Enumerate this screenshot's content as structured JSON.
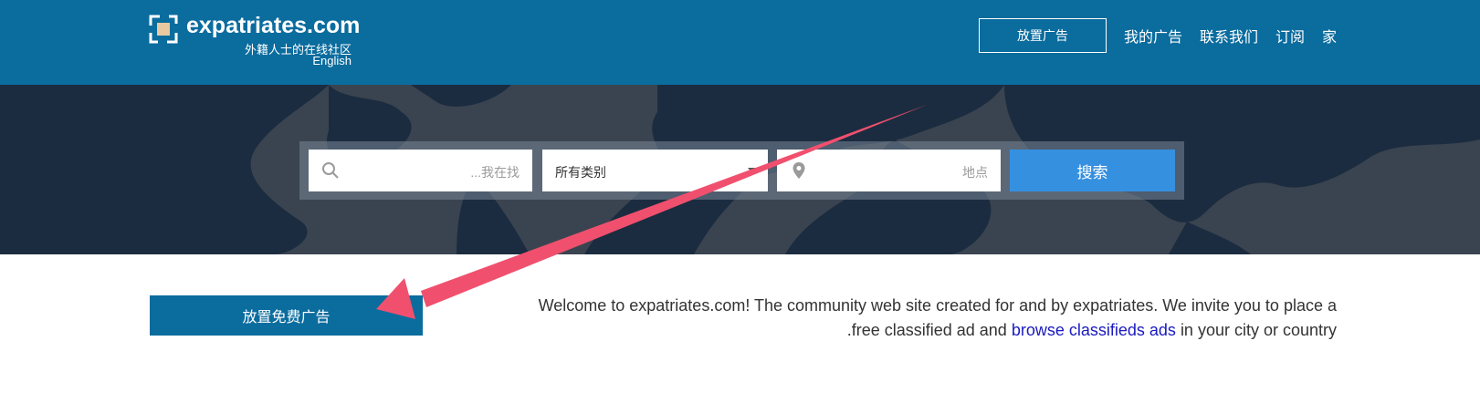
{
  "header": {
    "logo_name": "expatriates.com",
    "logo_subtitle": "外籍人士的在线社区",
    "logo_language": "English",
    "place_ad_label": "放置广告",
    "nav": [
      "我的广告",
      "联系我们",
      "订阅",
      "家"
    ]
  },
  "search": {
    "what_placeholder": "...我在找",
    "category_value": "所有类别",
    "location_placeholder": "地点",
    "button_label": "搜索"
  },
  "main": {
    "free_ad_button": "放置免费广告",
    "welcome_part1": "Welcome to expatriates.com! The community web site created for and by expatriates. We invite you to place a",
    "welcome_part2": ".free classified ad and",
    "welcome_link": "browse classifieds ads",
    "welcome_part3": "in your city or country"
  },
  "colors": {
    "header_bg": "#0b6c9e",
    "search_button": "#3690e0",
    "annotation_arrow": "#f0506e",
    "link": "#1a1abf"
  },
  "icons": [
    "logo-mark-icon",
    "search-icon",
    "location-pin-icon",
    "dropdown-caret-icon",
    "annotation-arrow"
  ]
}
